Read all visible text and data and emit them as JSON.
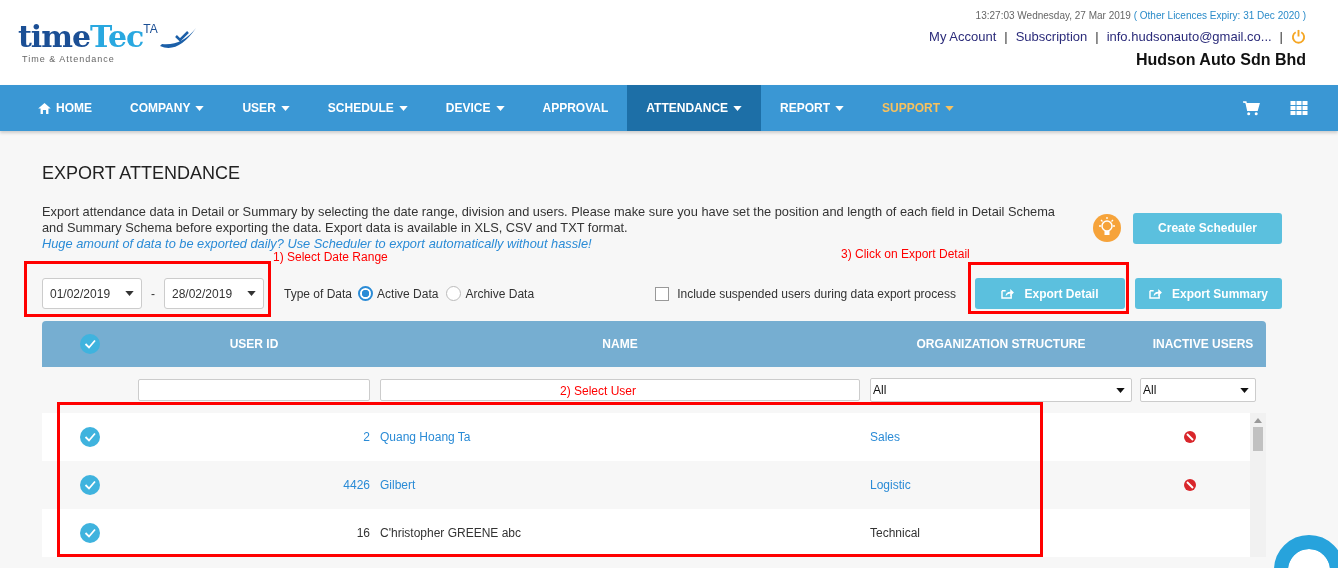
{
  "logo": {
    "name_dark": "time",
    "name_light": "Tec",
    "superscript": "TA",
    "tagline": "Time & Attendance"
  },
  "header": {
    "datetime": "13:27:03 Wednesday, 27 Mar 2019",
    "licence": "( Other Licences Expiry:  31 Dec 2020 )",
    "links": [
      "My Account",
      "Subscription",
      "info.hudsonauto@gmail.co..."
    ],
    "separator": "|",
    "company": "Hudson Auto Sdn Bhd"
  },
  "nav": [
    {
      "label": "HOME",
      "kind": "home",
      "dropdown": false,
      "selected": false
    },
    {
      "label": "COMPANY",
      "kind": "menu",
      "dropdown": true,
      "selected": false
    },
    {
      "label": "USER",
      "kind": "menu",
      "dropdown": true,
      "selected": false
    },
    {
      "label": "SCHEDULE",
      "kind": "menu",
      "dropdown": true,
      "selected": false
    },
    {
      "label": "DEVICE",
      "kind": "menu",
      "dropdown": true,
      "selected": false
    },
    {
      "label": "APPROVAL",
      "kind": "menu",
      "dropdown": false,
      "selected": false
    },
    {
      "label": "ATTENDANCE",
      "kind": "menu",
      "dropdown": true,
      "selected": true
    },
    {
      "label": "REPORT",
      "kind": "menu",
      "dropdown": true,
      "selected": false
    },
    {
      "label": "SUPPORT",
      "kind": "support",
      "dropdown": true,
      "selected": false
    }
  ],
  "page": {
    "title": "EXPORT ATTENDANCE",
    "description": "Export attendance data in Detail or Summary by selecting the date range, division and users. Please make sure you have set the position and length of each field in Detail Schema and Summary Schema before exporting the data. Export data is available in XLS, CSV and TXT format.",
    "hint_lines": [
      "Huge amount of data to be exported daily? Use Scheduler to export",
      "automatically without hassle!"
    ],
    "create_button": "Create Scheduler"
  },
  "filters": {
    "date_from": "01/02/2019",
    "date_sep": "-",
    "date_to": "28/02/2019",
    "type_label": "Type of Data",
    "types": [
      {
        "label": "Active Data",
        "selected": true
      },
      {
        "label": "Archive Data",
        "selected": false
      }
    ],
    "include_suspended": {
      "label": "Include suspended users during data export process",
      "checked": false
    },
    "buttons": [
      "Export Detail",
      "Export Summary"
    ]
  },
  "table": {
    "all_checked": true,
    "columns": [
      "USER ID",
      "NAME",
      "ORGANIZATION STRUCTURE",
      "INACTIVE USERS"
    ],
    "org_filter": "All",
    "inactive_filter": "All",
    "rows": [
      {
        "checked": true,
        "id": "2",
        "name": "Quang Hoang Ta",
        "org": "Sales",
        "inactive": true
      },
      {
        "checked": true,
        "id": "4426",
        "name": "Gilbert",
        "org": "Logistic",
        "inactive": true
      },
      {
        "checked": true,
        "id": "16",
        "name": "C'hristopher GREENE abc",
        "org": "Technical",
        "inactive": false
      }
    ]
  },
  "annotations": [
    "1) Select Date Range",
    "3) Click on Export Detail",
    "2) Select User"
  ]
}
